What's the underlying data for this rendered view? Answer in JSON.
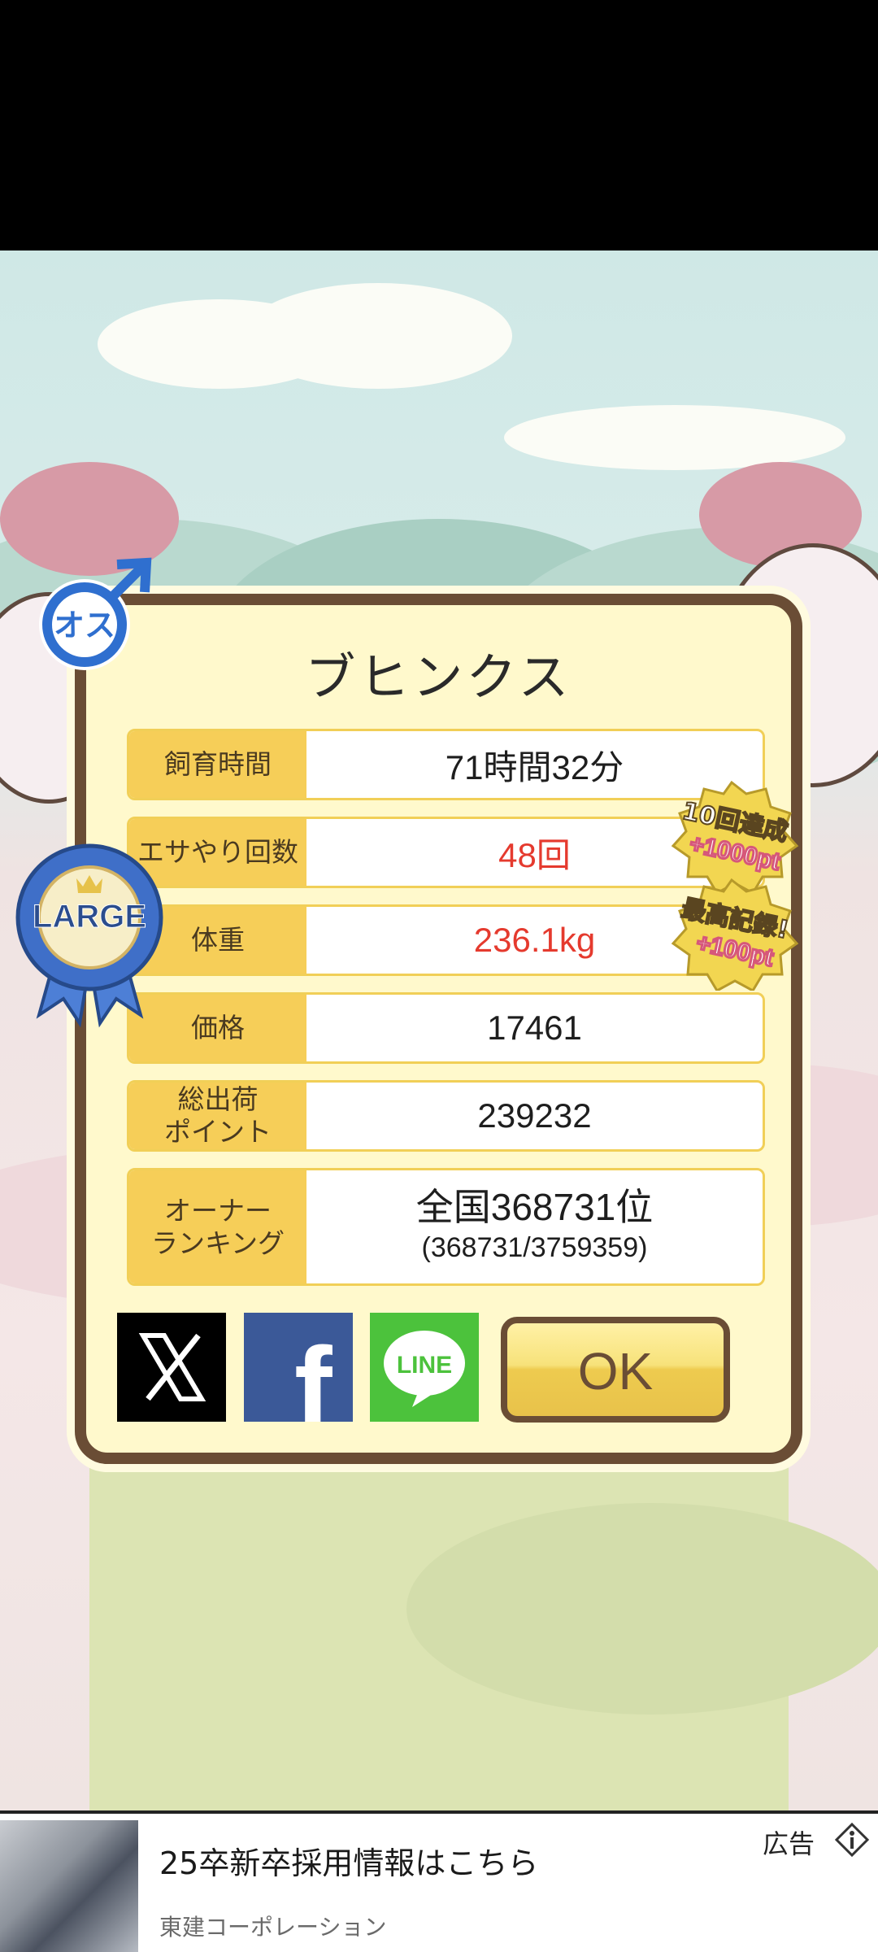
{
  "pet": {
    "name": "ブヒンクス",
    "gender_badge": "オス",
    "size_badge": "LARGE"
  },
  "stats": [
    {
      "label": "飼育時間",
      "value": "71時間32分",
      "highlight": false
    },
    {
      "label": "エサやり回数",
      "value": "48回",
      "highlight": true
    },
    {
      "label": "体重",
      "value": "236.1kg",
      "highlight": true
    },
    {
      "label": "価格",
      "value": "17461",
      "highlight": false
    },
    {
      "label": "総出荷\nポイント",
      "value": "239232",
      "highlight": false
    }
  ],
  "ranking": {
    "label": "オーナー\nランキング",
    "rank": "全国368731位",
    "detail": "(368731/3759359)"
  },
  "achievements": {
    "count_title": "10回達成",
    "count_bonus": "+1000pt",
    "record_title": "最高記録!",
    "record_bonus": "+100pt"
  },
  "share": {
    "x_label": "X",
    "facebook_label": "f",
    "line_label": "LINE"
  },
  "ok_label": "OK",
  "ad": {
    "title": "25卒新卒採用情報はこちら",
    "company": "東建コーポレーション",
    "tag": "広告"
  },
  "colors": {
    "frame": "#6a4d35",
    "label_bg": "#f6ce58",
    "dialog_bg": "#fff9cc",
    "highlight_text": "#e53a2e",
    "male_blue": "#2f6fcf"
  },
  "icons": [
    "male-symbol-icon",
    "large-ribbon-icon",
    "x-logo-icon",
    "facebook-logo-icon",
    "line-logo-icon",
    "ad-info-icon"
  ]
}
